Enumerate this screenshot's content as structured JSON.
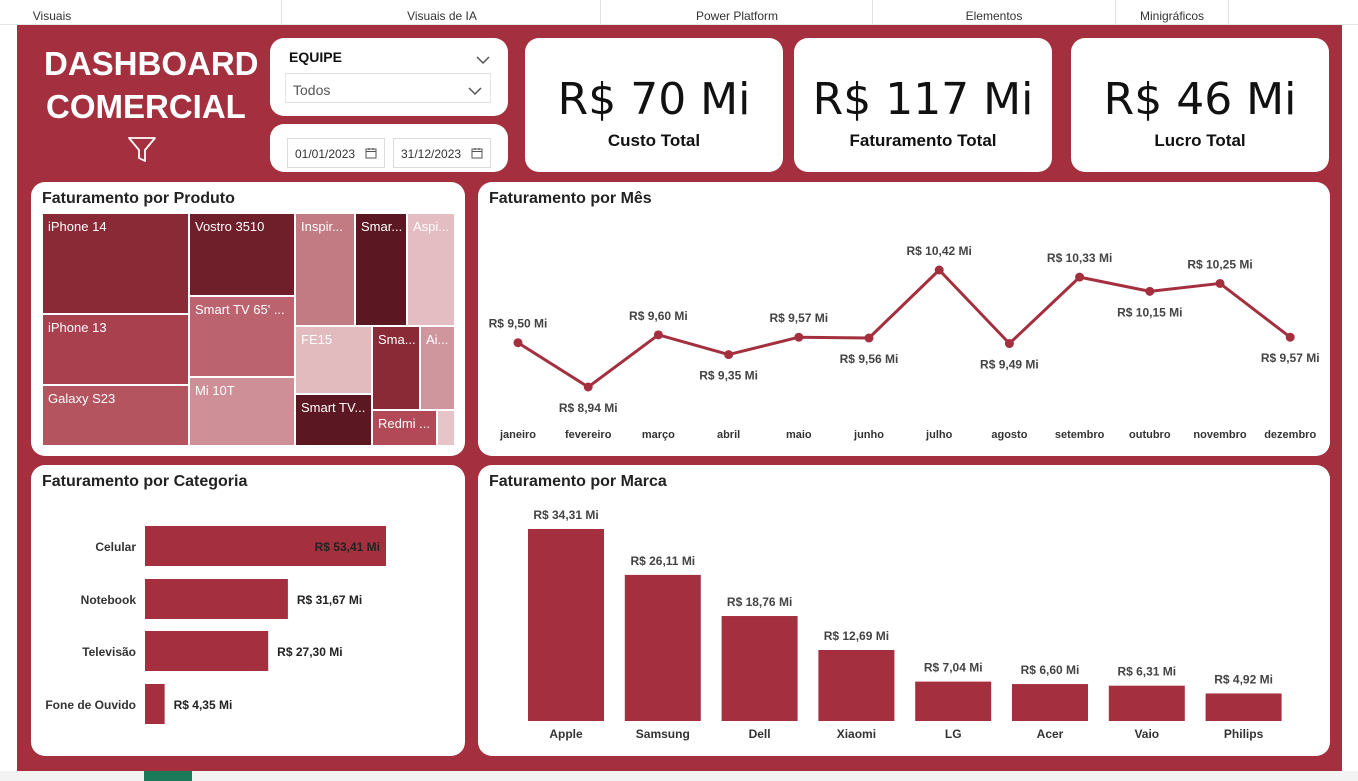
{
  "ribbon": {
    "tabs": [
      "Visuais",
      "Visuais de IA",
      "Power Platform",
      "Elementos",
      "Minigráficos"
    ]
  },
  "header": {
    "title_line1": "DASHBOARD",
    "title_line2": "COMERCIAL"
  },
  "slicer": {
    "title": "EQUIPE",
    "value": "Todos",
    "date_start": "01/01/2023",
    "date_end": "31/12/2023"
  },
  "kpis": [
    {
      "value": "R$ 70 Mi",
      "label": "Custo Total"
    },
    {
      "value": "R$ 117 Mi",
      "label": "Faturamento Total"
    },
    {
      "value": "R$ 46 Mi",
      "label": "Lucro Total"
    }
  ],
  "panels": {
    "produto": "Faturamento por Produto",
    "mes": "Faturamento por Mês",
    "categoria": "Faturamento por Categoria",
    "marca": "Faturamento por Marca"
  },
  "treemap": {
    "items": [
      {
        "label": "iPhone 14",
        "color": "#8a2a36"
      },
      {
        "label": "iPhone 13",
        "color": "#a8404e"
      },
      {
        "label": "Galaxy S23",
        "color": "#b4545f"
      },
      {
        "label": "Vostro 3510",
        "color": "#6e1f2a"
      },
      {
        "label": "Smart TV 65' ...",
        "color": "#bb6470"
      },
      {
        "label": "Mi 10T",
        "color": "#cf8f97"
      },
      {
        "label": "Inspir...",
        "color": "#c27a83"
      },
      {
        "label": "Smar...",
        "color": "#5c1822"
      },
      {
        "label": "Aspi...",
        "color": "#e3bdc2"
      },
      {
        "label": "FE15",
        "color": "#e2bbbf"
      },
      {
        "label": "Sma...",
        "color": "#8a2a36"
      },
      {
        "label": "Ai...",
        "color": "#d0969d"
      },
      {
        "label": "Smart TV...",
        "color": "#5c1822"
      },
      {
        "label": "Redmi ...",
        "color": "#b14a56"
      },
      {
        "label": "",
        "color": "#e6c4c8"
      }
    ]
  },
  "chart_data": [
    {
      "type": "line",
      "title": "Faturamento por Mês",
      "categories": [
        "janeiro",
        "fevereiro",
        "março",
        "abril",
        "maio",
        "junho",
        "julho",
        "agosto",
        "setembro",
        "outubro",
        "novembro",
        "dezembro"
      ],
      "values": [
        9.5,
        8.94,
        9.6,
        9.35,
        9.57,
        9.56,
        10.42,
        9.49,
        10.33,
        10.15,
        10.25,
        9.57
      ],
      "data_labels": [
        "R$ 9,50 Mi",
        "R$ 8,94 Mi",
        "R$ 9,60 Mi",
        "R$ 9,35 Mi",
        "R$ 9,57 Mi",
        "R$ 9,56 Mi",
        "R$ 10,42 Mi",
        "R$ 9,49 Mi",
        "R$ 10,33 Mi",
        "R$ 10,15 Mi",
        "R$ 10,25 Mi",
        "R$ 9,57 Mi"
      ],
      "color": "#a4303f",
      "grid": false
    },
    {
      "type": "bar",
      "orientation": "horizontal",
      "title": "Faturamento por Categoria",
      "categories": [
        "Celular",
        "Notebook",
        "Televisão",
        "Fone de Ouvido"
      ],
      "values": [
        53.41,
        31.67,
        27.3,
        4.35
      ],
      "data_labels": [
        "R$ 53,41 Mi",
        "R$ 31,67 Mi",
        "R$ 27,30 Mi",
        "R$ 4,35 Mi"
      ],
      "color": "#a4303f",
      "grid": false
    },
    {
      "type": "bar",
      "orientation": "vertical",
      "title": "Faturamento por Marca",
      "categories": [
        "Apple",
        "Samsung",
        "Dell",
        "Xiaomi",
        "LG",
        "Acer",
        "Vaio",
        "Philips"
      ],
      "values": [
        34.31,
        26.11,
        18.76,
        12.69,
        7.04,
        6.6,
        6.31,
        4.92
      ],
      "data_labels": [
        "R$ 34,31 Mi",
        "R$ 26,11 Mi",
        "R$ 18,76 Mi",
        "R$ 12,69 Mi",
        "R$ 7,04 Mi",
        "R$ 6,60 Mi",
        "R$ 6,31 Mi",
        "R$ 4,92 Mi"
      ],
      "color": "#a4303f",
      "grid": false
    }
  ]
}
